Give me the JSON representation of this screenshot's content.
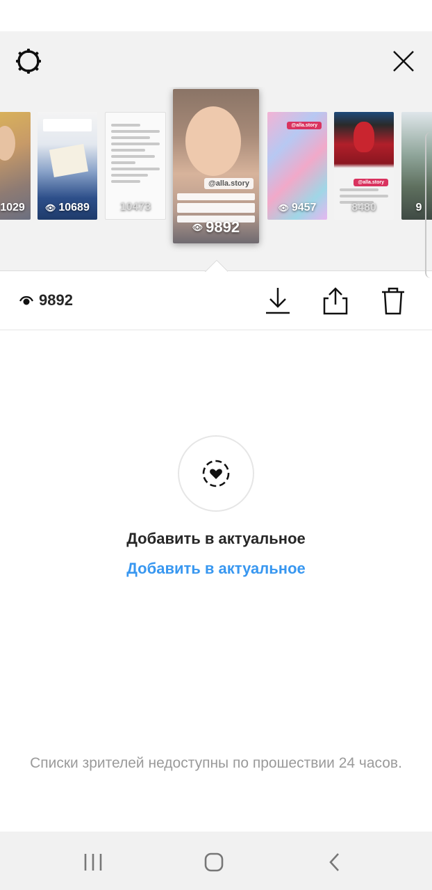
{
  "header": {
    "settings_icon": "gear-icon",
    "close_icon": "close-icon"
  },
  "stories": [
    {
      "views": "1029",
      "partial": true
    },
    {
      "views": "10689"
    },
    {
      "views": "10473"
    },
    {
      "views": "9892",
      "active": true,
      "handle": "@alla.story"
    },
    {
      "views": "9457",
      "handle": "@alla.story"
    },
    {
      "views": "8480",
      "handle": "@alla.story"
    },
    {
      "views": "9",
      "partial": true
    }
  ],
  "current": {
    "views": "9892",
    "eye_icon": "eye-icon",
    "actions": [
      "download-icon",
      "share-icon",
      "trash-icon"
    ]
  },
  "highlight": {
    "icon": "highlight-heart-icon",
    "title": "Добавить в актуальное",
    "link": "Добавить в актуальное"
  },
  "viewers_note": "Списки зрителей недоступны по прошествии 24 часов.",
  "navbar": {
    "recents_icon": "recents-icon",
    "home_icon": "home-icon",
    "back_icon": "back-icon"
  },
  "colors": {
    "accent": "#3897f0",
    "text": "#262626",
    "muted": "#9a9a9a",
    "panel": "#f2f2f2"
  }
}
